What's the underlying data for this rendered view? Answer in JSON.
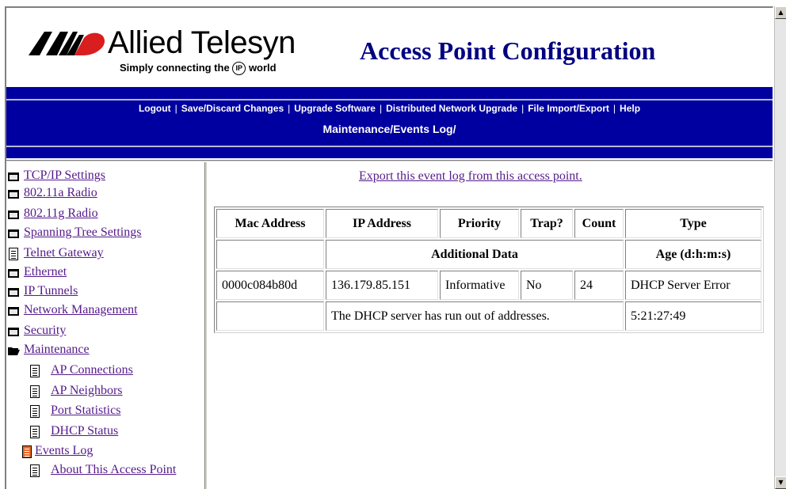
{
  "brand": {
    "name": "Allied Telesyn",
    "tagline_prefix": "Simply connecting the",
    "tagline_ip": "IP",
    "tagline_suffix": "world"
  },
  "header": {
    "title": "Access Point Configuration"
  },
  "top_nav": [
    "Logout",
    "Save/Discard Changes",
    "Upgrade Software",
    "Distributed Network Upgrade",
    "File Import/Export",
    "Help"
  ],
  "section_path": "Maintenance/Events Log/",
  "sidebar": {
    "items": [
      {
        "label": "TCP/IP Settings",
        "icon": "folder-icon"
      },
      {
        "label": "802.11a Radio",
        "icon": "folder-icon"
      },
      {
        "label": "802.11g Radio",
        "icon": "folder-icon"
      },
      {
        "label": "Spanning Tree Settings",
        "icon": "folder-icon"
      },
      {
        "label": "Telnet Gateway",
        "icon": "page-icon"
      },
      {
        "label": "Ethernet",
        "icon": "folder-icon"
      },
      {
        "label": "IP Tunnels",
        "icon": "folder-icon"
      },
      {
        "label": "Network Management",
        "icon": "folder-icon"
      },
      {
        "label": "Security",
        "icon": "folder-icon"
      },
      {
        "label": "Maintenance",
        "icon": "folder-open-icon"
      }
    ],
    "subitems": [
      {
        "label": "AP Connections",
        "icon": "page-icon"
      },
      {
        "label": "AP Neighbors",
        "icon": "page-icon"
      },
      {
        "label": "Port Statistics",
        "icon": "page-icon"
      },
      {
        "label": "DHCP Status",
        "icon": "page-icon"
      },
      {
        "label": "Events Log",
        "icon": "page-icon",
        "active": true
      },
      {
        "label": "About This Access Point",
        "icon": "page-icon"
      }
    ]
  },
  "main": {
    "export_link": "Export this event log from this access point.",
    "table": {
      "headers": [
        "Mac Address",
        "IP Address",
        "Priority",
        "Trap?",
        "Count",
        "Type"
      ],
      "subheaders": [
        "",
        "Additional Data",
        "Age (d:h:m:s)"
      ],
      "row": {
        "mac": "0000c084b80d",
        "ip": "136.179.85.151",
        "priority": "Informative",
        "trap": "No",
        "count": "24",
        "type": "DHCP Server Error"
      },
      "detail": {
        "blank": "",
        "additional_data": "The DHCP server has run out of addresses.",
        "age": "5:21:27:49"
      }
    }
  },
  "colors": {
    "band_blue": "#0000a0",
    "title_navy": "#000080",
    "visited_link": "#551a8b",
    "logo_red": "#d81e1e",
    "active_page_orange": "#e86a2a"
  }
}
